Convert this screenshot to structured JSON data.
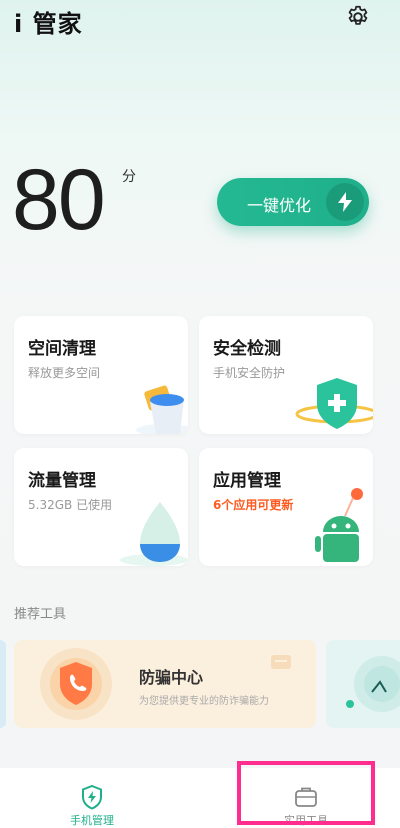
{
  "header": {
    "title": "i 管家",
    "settings_icon": "gear-icon"
  },
  "score": {
    "value": "80",
    "unit": "分"
  },
  "optimize_button": {
    "label": "一键优化",
    "icon": "lightning-icon",
    "color": "#1faf8a"
  },
  "cards": [
    {
      "title": "空间清理",
      "subtitle": "释放更多空间"
    },
    {
      "title": "安全检测",
      "subtitle": "手机安全防护"
    },
    {
      "title": "流量管理",
      "subtitle": "5.32GB 已使用"
    },
    {
      "title": "应用管理",
      "subtitle": "6个应用可更新",
      "subtitle_color": "#ff5a1f"
    }
  ],
  "recommended": {
    "section_title": "推荐工具",
    "banner": {
      "title": "防骗中心",
      "description": "为您提供更专业的防诈骗能力"
    }
  },
  "tabbar": {
    "tabs": [
      {
        "label": "手机管理",
        "icon": "shield-bolt-icon",
        "active": true
      },
      {
        "label": "实用工具",
        "icon": "toolbox-icon",
        "active": false
      }
    ],
    "highlight_color": "#ff2d8f"
  }
}
